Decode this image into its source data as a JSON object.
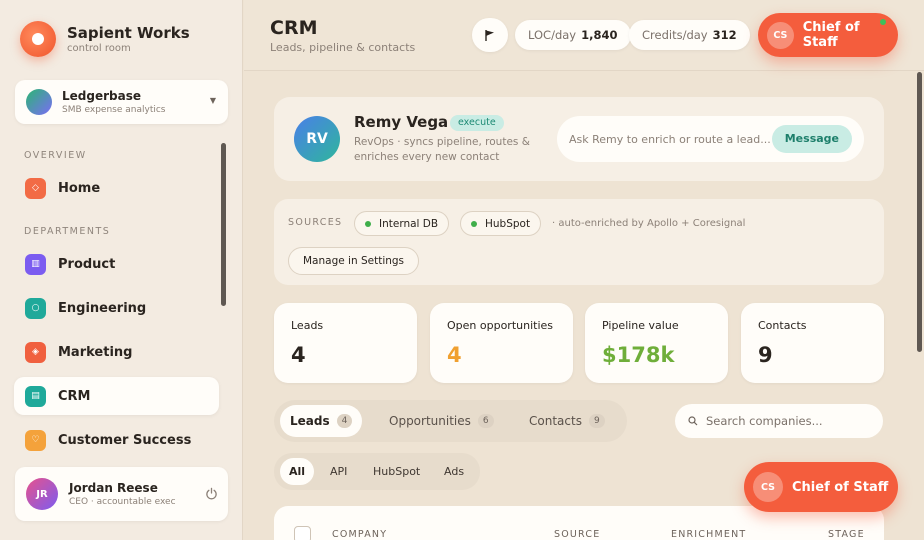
{
  "brand": {
    "name": "Sapient Works",
    "subtitle": "control room"
  },
  "org": {
    "name": "Ledgerbase",
    "subtitle": "SMB expense analytics"
  },
  "sidebar": {
    "overview_label": "OVERVIEW",
    "departments_label": "DEPARTMENTS",
    "items": [
      {
        "label": "Home",
        "icon": "home-icon",
        "color": "#f26b45"
      },
      {
        "label": "Product",
        "icon": "product-icon",
        "color": "#7b5cf0"
      },
      {
        "label": "Engineering",
        "icon": "engineering-icon",
        "color": "#1fa99a"
      },
      {
        "label": "Marketing",
        "icon": "marketing-icon",
        "color": "#f0603f"
      },
      {
        "label": "CRM",
        "icon": "crm-icon",
        "color": "#1fa99a"
      },
      {
        "label": "Customer Success",
        "icon": "heart-icon",
        "color": "#f4a23b"
      }
    ],
    "active": "CRM"
  },
  "user": {
    "initials": "JR",
    "name": "Jordan Reese",
    "role": "CEO · accountable exec"
  },
  "header": {
    "title": "CRM",
    "subtitle": "Leads, pipeline & contacts",
    "loc_label": "LOC/day",
    "loc_value": "1,840",
    "credits_label": "Credits/day",
    "credits_value": "312",
    "cos_initials": "CS",
    "cos_label": "Chief of Staff"
  },
  "agent": {
    "initials": "RV",
    "name": "Remy Vega",
    "tag": "execute",
    "description": "RevOps · syncs pipeline, routes & enriches every new contact",
    "ask_placeholder": "Ask Remy to enrich or route a lead...",
    "message_label": "Message"
  },
  "sources": {
    "label": "SOURCES",
    "items": [
      {
        "label": "Internal DB",
        "dot_color": "#3fae4a"
      },
      {
        "label": "HubSpot",
        "dot_color": "#3fae4a"
      }
    ],
    "note": "· auto-enriched by Apollo + Coresignal",
    "settings_label": "Manage in Settings"
  },
  "metrics": [
    {
      "label": "Leads",
      "value": "4",
      "color": "#2a241f"
    },
    {
      "label": "Open opportunities",
      "value": "4",
      "color": "#f0a030"
    },
    {
      "label": "Pipeline value",
      "value": "$178k",
      "color": "#6fae3a"
    },
    {
      "label": "Contacts",
      "value": "9",
      "color": "#2a241f"
    }
  ],
  "tabs": [
    {
      "label": "Leads",
      "count": "4"
    },
    {
      "label": "Opportunities",
      "count": "6"
    },
    {
      "label": "Contacts",
      "count": "9"
    }
  ],
  "search": {
    "placeholder": "Search companies..."
  },
  "filters": [
    "All",
    "API",
    "HubSpot",
    "Ads"
  ],
  "table": {
    "columns": [
      "COMPANY",
      "SOURCE",
      "ENRICHMENT",
      "STAGE"
    ]
  },
  "floating_cos": {
    "initials": "CS",
    "label": "Chief of Staff"
  }
}
